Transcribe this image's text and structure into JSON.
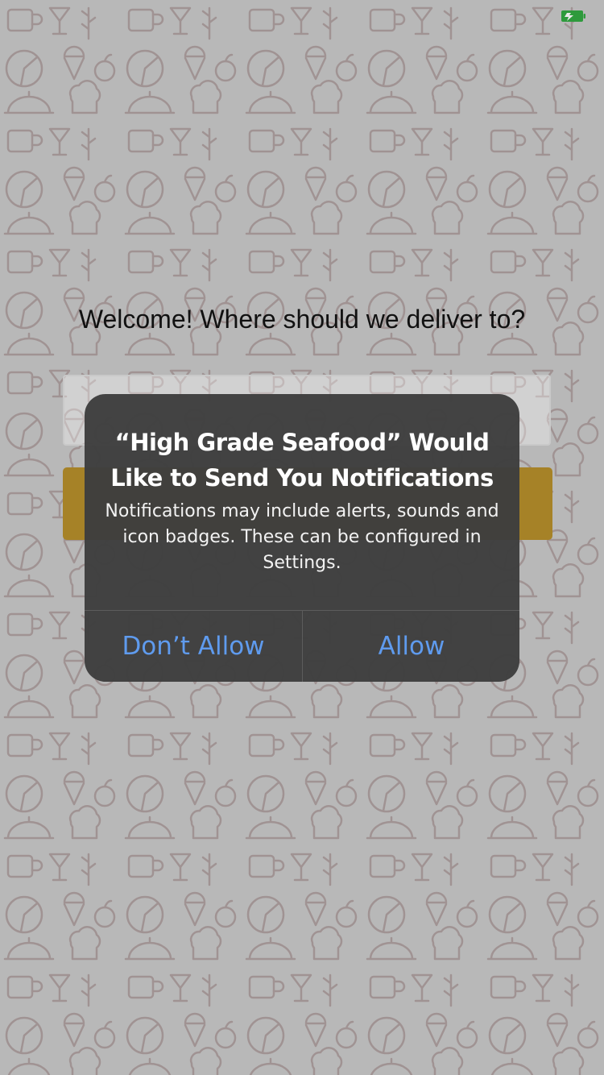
{
  "screen": {
    "welcome_title": "Welcome! Where should we deliver to?",
    "address_input": {
      "value": "",
      "placeholder": ""
    },
    "submit_button_label": ""
  },
  "alert": {
    "title": "“High Grade Seafood” Would Like to Send You Notifications",
    "message": "Notifications may include alerts, sounds and icon badges. These can be configured in Settings.",
    "buttons": {
      "dont_allow": "Don’t Allow",
      "allow": "Allow"
    }
  },
  "colors": {
    "accent_button": "#a68227",
    "alert_background": "#3e3e3e",
    "alert_button_text": "#5f9bee",
    "status_indicator": "#2e9a3c"
  },
  "icons": {
    "status_indicator": "battery-charging-icon",
    "background_pattern": "food-doodle-pattern"
  }
}
